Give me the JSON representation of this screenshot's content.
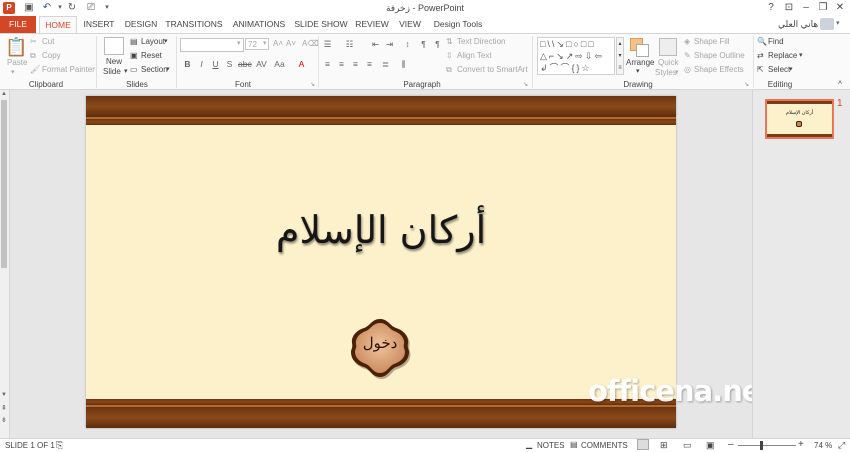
{
  "window": {
    "title": "زخرفة - PowerPoint",
    "user_name": "هاني العلي"
  },
  "tabs": [
    "FILE",
    "HOME",
    "INSERT",
    "DESIGN",
    "TRANSITIONS",
    "ANIMATIONS",
    "SLIDE SHOW",
    "REVIEW",
    "VIEW",
    "Design Tools"
  ],
  "ribbon": {
    "clipboard": {
      "paste": "Paste",
      "cut": "Cut",
      "copy": "Copy",
      "format_painter": "Format Painter",
      "label": "Clipboard"
    },
    "slides": {
      "new_slide_1": "New",
      "new_slide_2": "Slide",
      "layout": "Layout",
      "reset": "Reset",
      "section": "Section",
      "label": "Slides"
    },
    "font": {
      "size": "72",
      "label": "Font"
    },
    "paragraph": {
      "text_direction": "Text Direction",
      "align_text": "Align Text",
      "convert_smartart": "Convert to SmartArt",
      "label": "Paragraph"
    },
    "drawing": {
      "arrange": "Arrange",
      "quick_styles_1": "Quick",
      "quick_styles_2": "Styles",
      "shape_fill": "Shape Fill",
      "shape_outline": "Shape Outline",
      "shape_effects": "Shape Effects",
      "label": "Drawing"
    },
    "editing": {
      "find": "Find",
      "replace": "Replace",
      "select": "Select",
      "label": "Editing"
    }
  },
  "slide": {
    "title": "أركان الإسلام",
    "button_label": "دخول",
    "watermark": "officena.net"
  },
  "thumbnail": {
    "number": "1",
    "title": "أركان الإسلام"
  },
  "status": {
    "slide_of": "SLIDE 1 OF 1",
    "notes": "NOTES",
    "comments": "COMMENTS",
    "zoom": "74 %"
  },
  "colors": {
    "accent": "#d24726",
    "slide_bg": "#fdf1cc",
    "band": "#6a3410"
  }
}
